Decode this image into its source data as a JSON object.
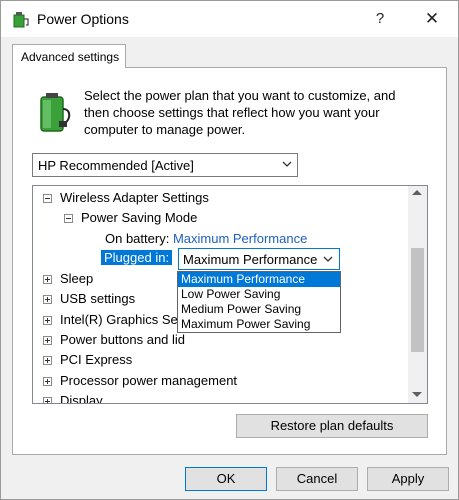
{
  "window": {
    "title": "Power Options",
    "help_label": "?",
    "close_label": "✕"
  },
  "tab": {
    "label": "Advanced settings"
  },
  "description": "Select the power plan that you want to customize, and then choose settings that reflect how you want your computer to manage power.",
  "plan_select": {
    "value": "HP Recommended [Active]"
  },
  "tree": {
    "wireless": "Wireless Adapter Settings",
    "power_saving": "Power Saving Mode",
    "on_battery_label": "On battery:",
    "on_battery_value": "Maximum Performance",
    "plugged_in_label": "Plugged in:",
    "plugged_in_value": "Maximum Performance",
    "items": [
      "Sleep",
      "USB settings",
      "Intel(R) Graphics Settings",
      "Power buttons and lid",
      "PCI Express",
      "Processor power management",
      "Display"
    ]
  },
  "dropdown_options": [
    "Maximum Performance",
    "Low Power Saving",
    "Medium Power Saving",
    "Maximum Power Saving"
  ],
  "buttons": {
    "restore": "Restore plan defaults",
    "ok": "OK",
    "cancel": "Cancel",
    "apply": "Apply"
  },
  "colors": {
    "accent": "#0078d7",
    "link": "#1f5fbf",
    "battery_green": "#3aa13a"
  }
}
